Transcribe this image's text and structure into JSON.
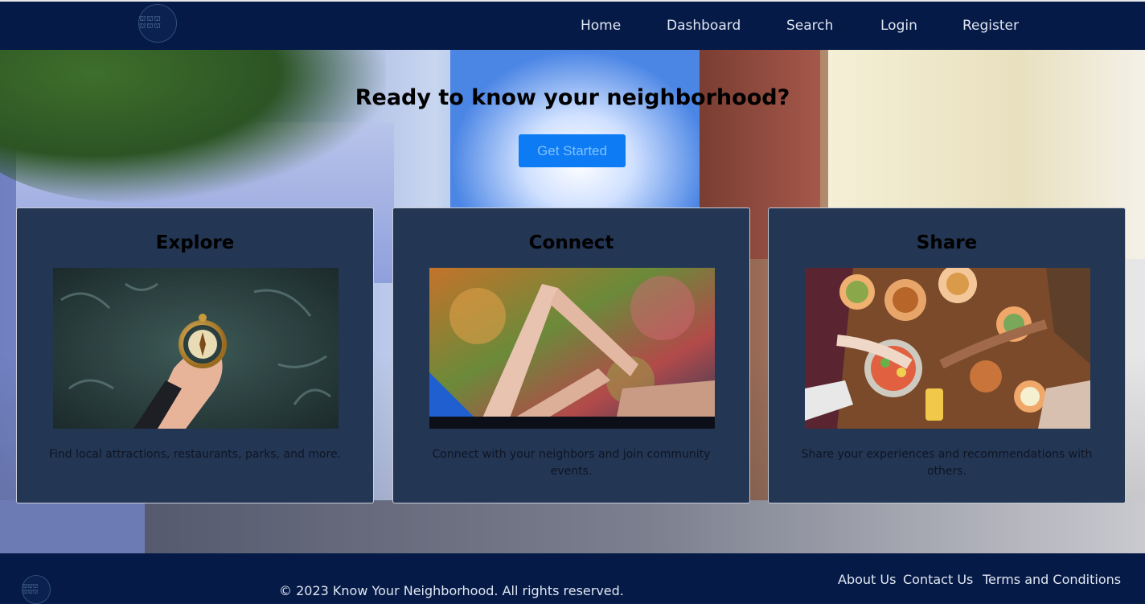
{
  "brand": {
    "logo_glyphs": "⛫⛫⛫ ⛫⛫⛫",
    "logo_text": "Know Your Neighborhood"
  },
  "nav": {
    "items": [
      {
        "label": "Home"
      },
      {
        "label": "Dashboard"
      },
      {
        "label": "Search"
      },
      {
        "label": "Login"
      },
      {
        "label": "Register"
      }
    ]
  },
  "hero": {
    "title": "Ready to know your neighborhood?",
    "cta_label": "Get Started"
  },
  "cards": [
    {
      "title": "Explore",
      "image": "hand-holding-compass-image",
      "text": "Find local attractions, restaurants, parks, and more."
    },
    {
      "title": "Connect",
      "image": "fingers-forming-triangle-image",
      "text": "Connect with your neighbors and join community events."
    },
    {
      "title": "Share",
      "image": "shared-meal-table-image",
      "text": "Share your experiences and recommendations with others."
    }
  ],
  "footer": {
    "copyright": "© 2023 Know Your Neighborhood. All rights reserved.",
    "links": [
      {
        "label": "About Us"
      },
      {
        "label": "Contact Us"
      },
      {
        "label": "Terms and Conditions"
      }
    ]
  },
  "colors": {
    "navbar_bg": "#061a47",
    "card_bg": "#233654",
    "cta_bg": "#0d7bf4",
    "cta_text": "#7fc2ff"
  }
}
